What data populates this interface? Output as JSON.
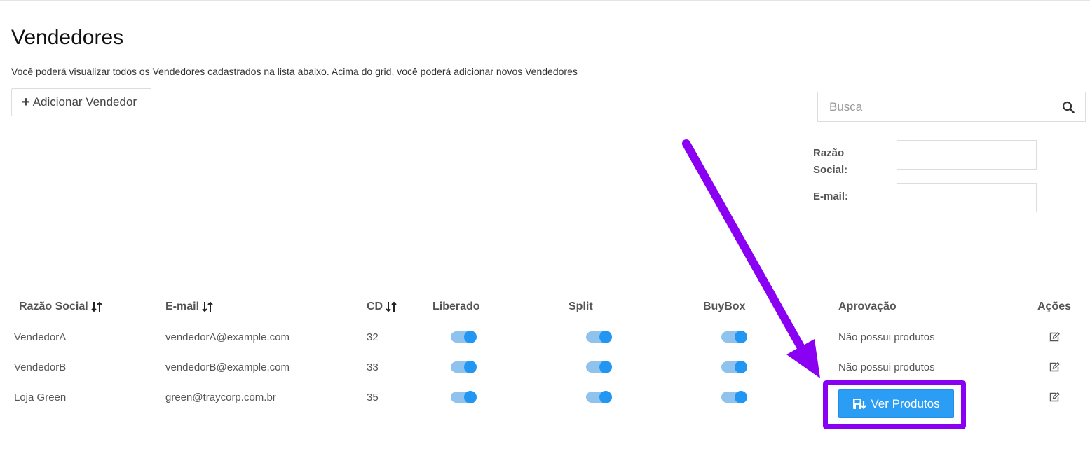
{
  "page": {
    "title": "Vendedores",
    "description": "Você poderá visualizar todos os Vendedores cadastrados na lista abaixo. Acima do grid, você poderá adicionar novos Vendedores"
  },
  "toolbar": {
    "add_label": "Adicionar Vendedor"
  },
  "search": {
    "placeholder": "Busca",
    "value": ""
  },
  "filters": {
    "razao_social_label_line1": "Razão",
    "razao_social_label_line2": "Social:",
    "email_label": "E-mail:"
  },
  "table": {
    "headers": {
      "razao_social": "Razão Social",
      "email": "E-mail",
      "cd": "CD",
      "liberado": "Liberado",
      "split": "Split",
      "buybox": "BuyBox",
      "aprovacao": "Aprovação",
      "acoes": "Ações"
    },
    "rows": [
      {
        "razao_social": "VendedorA",
        "email": "vendedorA@example.com",
        "cd": "32",
        "liberado": true,
        "split": true,
        "buybox": true,
        "aprovacao": "Não possui produtos"
      },
      {
        "razao_social": "VendedorB",
        "email": "vendedorB@example.com",
        "cd": "33",
        "liberado": true,
        "split": true,
        "buybox": true,
        "aprovacao": "Não possui produtos"
      },
      {
        "razao_social": "Loja Green",
        "email": "green@traycorp.com.br",
        "cd": "35",
        "liberado": true,
        "split": true,
        "buybox": true,
        "aprovacao_button": "Ver Produtos"
      }
    ]
  },
  "colors": {
    "primary_button": "#2b9df4",
    "toggle_on": "#2196f3",
    "annotation": "#8a00f2"
  },
  "icons": {
    "add": "plus-icon",
    "search": "search-icon",
    "sort": "sort-icon",
    "edit": "edit-icon",
    "products": "boxes-icon"
  }
}
